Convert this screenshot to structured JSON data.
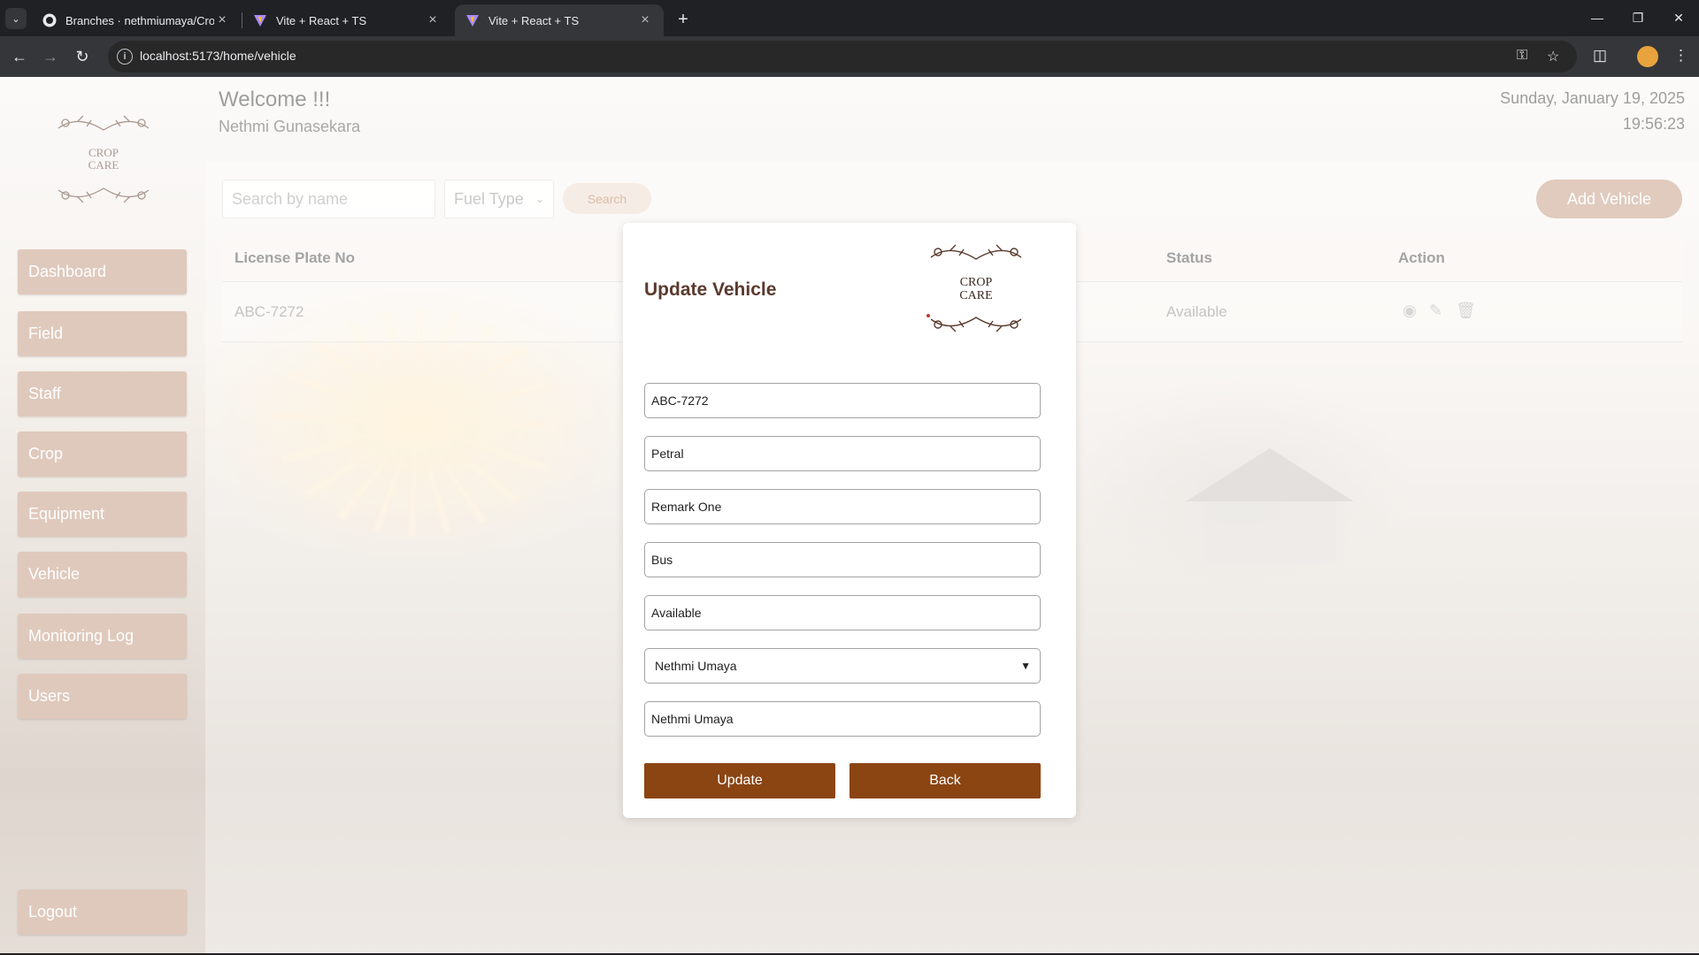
{
  "browser": {
    "tabs": [
      {
        "title": "Branches · nethmiumaya/CropC",
        "favicon": "github-icon"
      },
      {
        "title": "Vite + React + TS",
        "favicon": "vite-icon"
      },
      {
        "title": "Vite + React + TS",
        "favicon": "vite-icon",
        "active": true
      }
    ],
    "url": "localhost:5173/home/vehicle"
  },
  "header": {
    "welcome": "Welcome !!!",
    "username": "Nethmi Gunasekara",
    "date": "Sunday, January 19, 2025",
    "time": "19:56:23"
  },
  "logo": {
    "line1": "CROP",
    "line2": "CARE"
  },
  "sidebar": {
    "items": [
      {
        "label": "Dashboard"
      },
      {
        "label": "Field"
      },
      {
        "label": "Staff"
      },
      {
        "label": "Crop"
      },
      {
        "label": "Equipment"
      },
      {
        "label": "Vehicle"
      },
      {
        "label": "Monitoring Log"
      },
      {
        "label": "Users"
      }
    ],
    "logout": "Logout"
  },
  "filters": {
    "search_placeholder": "Search by name",
    "fuel_type": "Fuel Type",
    "search_button": "Search",
    "add_button": "Add Vehicle"
  },
  "table": {
    "columns": [
      "License Plate No",
      "Status",
      "Action"
    ],
    "rows": [
      {
        "license": "ABC-7272",
        "status": "Available"
      }
    ]
  },
  "modal": {
    "title": "Update Vehicle",
    "fields": {
      "license_plate": "ABC-7272",
      "fuel_type": "Petral",
      "remarks": "Remark One",
      "category": "Bus",
      "status": "Available",
      "staff_select": "Nethmi Umaya",
      "staff_name": "Nethmi Umaya"
    },
    "update_button": "Update",
    "back_button": "Back"
  },
  "colors": {
    "accent_brown": "#8b4513",
    "title_brown": "#5b3a2e",
    "nav_item": "#dfc9bc"
  }
}
